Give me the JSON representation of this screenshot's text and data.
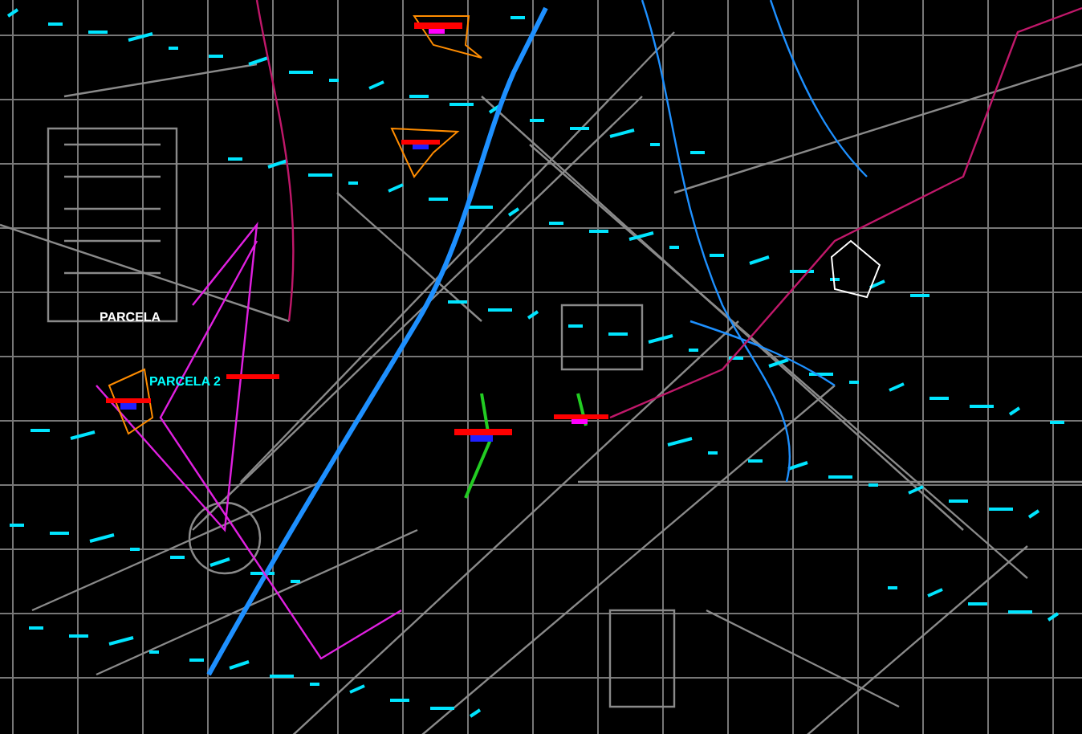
{
  "map_labels": [
    {
      "text": "PARCELA",
      "color": "#ffffff"
    },
    {
      "text": "PARCELA 2",
      "color": "#00ffff"
    }
  ]
}
